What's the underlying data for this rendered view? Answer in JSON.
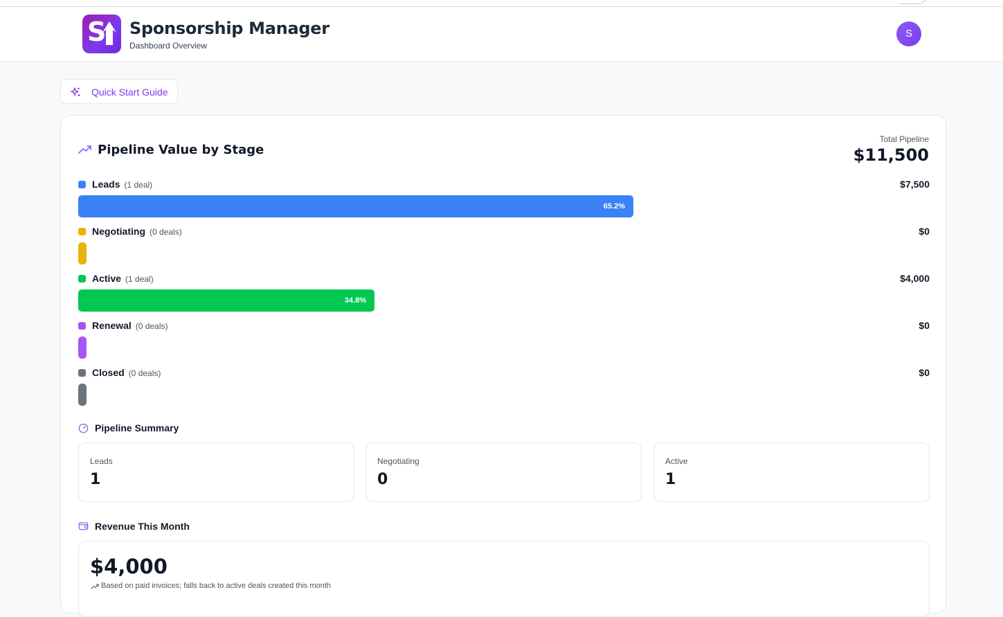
{
  "header": {
    "logo_text": "S",
    "title": "Sponsorship Manager",
    "subtitle": "Dashboard Overview",
    "avatar_initial": "S"
  },
  "quick_start": {
    "label": "Quick Start Guide"
  },
  "pipeline": {
    "title": "Pipeline Value by Stage",
    "total_label": "Total Pipeline",
    "total_value": "$11,500",
    "stages": [
      {
        "name": "Leads",
        "count": "(1 deal)",
        "amount": "$7,500",
        "percent_label": "65.2%",
        "fraction": 0.652,
        "color": "#3b82f6"
      },
      {
        "name": "Negotiating",
        "count": "(0 deals)",
        "amount": "$0",
        "percent_label": "",
        "fraction": 0,
        "color": "#eab308"
      },
      {
        "name": "Active",
        "count": "(1 deal)",
        "amount": "$4,000",
        "percent_label": "34.8%",
        "fraction": 0.348,
        "color": "#00c853"
      },
      {
        "name": "Renewal",
        "count": "(0 deals)",
        "amount": "$0",
        "percent_label": "",
        "fraction": 0,
        "color": "#a855f7"
      },
      {
        "name": "Closed",
        "count": "(0 deals)",
        "amount": "$0",
        "percent_label": "",
        "fraction": 0,
        "color": "#6b7280"
      }
    ]
  },
  "summary": {
    "title": "Pipeline Summary",
    "boxes": [
      {
        "label": "Leads",
        "value": "1"
      },
      {
        "label": "Negotiating",
        "value": "0"
      },
      {
        "label": "Active",
        "value": "1"
      }
    ]
  },
  "revenue": {
    "title": "Revenue This Month",
    "value": "$4,000",
    "note": "Based on paid invoices; falls back to active deals created this month"
  },
  "colors": {
    "accent": "#7c3aed"
  }
}
